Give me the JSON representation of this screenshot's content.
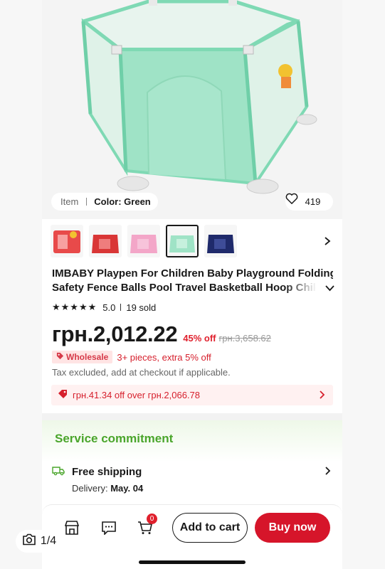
{
  "gallery": {
    "item_label": "Item",
    "color_label": "Color: Green",
    "like_icon": "heart-icon",
    "likes": "419",
    "counter": "1/4",
    "camera_icon": "camera-icon"
  },
  "variants": [
    {
      "color": "red-with-basket",
      "selected": false
    },
    {
      "color": "red",
      "selected": false
    },
    {
      "color": "pink",
      "selected": false
    },
    {
      "color": "green",
      "selected": true
    },
    {
      "color": "navy",
      "selected": false
    }
  ],
  "product": {
    "title_line1": "IMBABY Playpen For Children Baby Playground Folding",
    "title_line2": "Safety Fence Balls Pool Travel Basketball Hoop Childr...",
    "rating": "5.0",
    "sold": "19 sold",
    "price": "грн.2,012.22",
    "discount": "45% off",
    "original_price": "грн.3,658.62",
    "wholesale_badge": "Wholesale",
    "wholesale_text": "3+ pieces, extra 5% off",
    "tax_note": "Tax excluded, add at checkout if applicable.",
    "coupon_text": "грн.41.34 off over грн.2,066.78"
  },
  "service": {
    "title": "Service commitment",
    "shipping_title": "Free shipping",
    "delivery_label": "Delivery:",
    "delivery_date": "May. 04"
  },
  "bottom_bar": {
    "cart_count": "0",
    "add_to_cart": "Add to cart",
    "buy_now": "Buy now"
  },
  "colors": {
    "accent_red": "#d6152a",
    "service_green": "#4aa52b",
    "product_mint": "#9fe3c6"
  }
}
